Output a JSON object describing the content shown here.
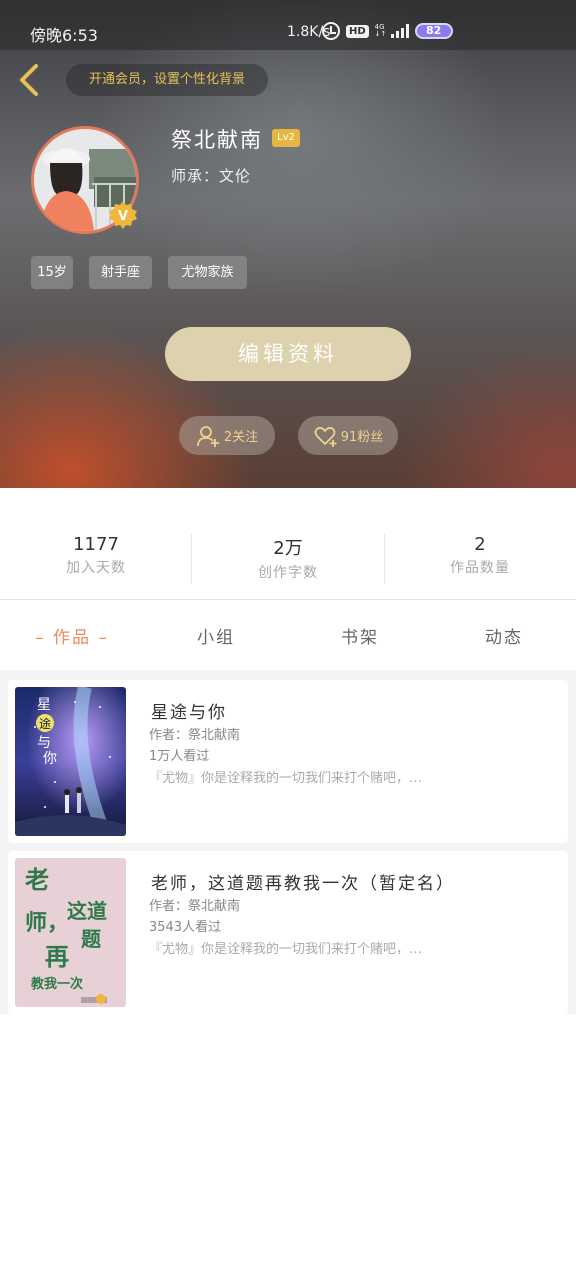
{
  "status_bar": {
    "time": "傍晚6:53",
    "network_speed": "1.8K/s",
    "battery": "82",
    "icons": [
      "alarm-icon",
      "hd-icon",
      "4g-icon",
      "signal-icon",
      "battery-icon"
    ]
  },
  "header": {
    "back_icon": "chevron-left-icon",
    "vip_banner": "开通会员，设置个性化背景"
  },
  "profile": {
    "username": "祭北献南",
    "level": "Lv2",
    "mentor": "师承：文伦",
    "tags": [
      "15岁",
      "射手座",
      "尤物家族"
    ],
    "edit_button": "编辑资料",
    "follow_label": "2关注",
    "fans_label": "91粉丝"
  },
  "stats": [
    {
      "value": "1177",
      "label": "加入天数"
    },
    {
      "value": "2万",
      "label": "创作字数"
    },
    {
      "value": "2",
      "label": "作品数量"
    }
  ],
  "tabs": [
    "– 作品 –",
    "小组",
    "书架",
    "动态"
  ],
  "books": [
    {
      "title": "星途与你",
      "author": "作者：祭北献南",
      "views": "1万人看过",
      "description": "『尤物』你是诠释我的一切我们来打个赌吧，…",
      "cover_text": [
        "星",
        "途",
        "与",
        "你"
      ]
    },
    {
      "title": "老师，这道题再教我一次（暂定名）",
      "author": "作者：祭北献南",
      "views": "3543人看过",
      "description": "『尤物』你是诠释我的一切我们来打个赌吧，…",
      "cover_text": [
        "老",
        "师，",
        "这道",
        "再",
        "题",
        "教我一次"
      ]
    }
  ],
  "colors": {
    "accent": "#e98d5a",
    "gold": "#e5b640",
    "edit_button": "#ddd2ad"
  }
}
